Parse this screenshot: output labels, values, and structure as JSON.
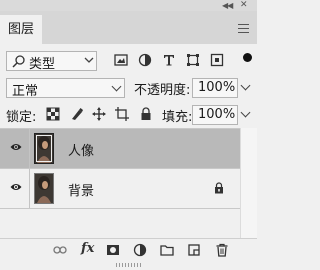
{
  "panel": {
    "tab_title": "图层"
  },
  "filter": {
    "kind_label": "类型",
    "icons": [
      "image-filter-icon",
      "adjustment-filter-icon",
      "type-filter-icon",
      "shape-filter-icon",
      "smart-object-filter-icon"
    ]
  },
  "blend": {
    "mode": "正常",
    "opacity_label": "不透明度:",
    "opacity_value": "100%"
  },
  "lock": {
    "label": "锁定:",
    "icons": [
      "lock-transparent-pixels-icon",
      "lock-image-pixels-icon",
      "lock-position-icon",
      "lock-artboard-icon",
      "lock-all-icon"
    ],
    "fill_label": "填充:",
    "fill_value": "100%"
  },
  "layers": [
    {
      "name": "人像",
      "selected": true,
      "locked": false
    },
    {
      "name": "背景",
      "selected": false,
      "locked": true
    }
  ],
  "colors": {
    "panel_bg": "#f0f0f0",
    "selected_row": "#b9b9b9",
    "header_bg": "#d6d6d6"
  }
}
